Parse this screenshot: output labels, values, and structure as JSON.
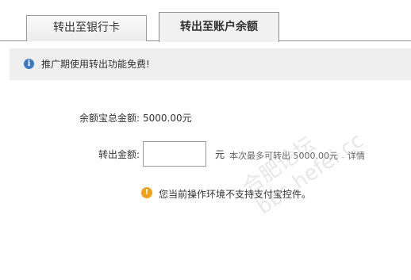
{
  "tabs": [
    {
      "label": "转出至银行卡",
      "active": false
    },
    {
      "label": "转出至账户余额",
      "active": true
    }
  ],
  "notice": {
    "icon": "info-icon",
    "text": "推广期使用转出功能免费!"
  },
  "form": {
    "total_label": "余额宝总金额:",
    "total_value": "5000.00元",
    "amount_label": "转出金额:",
    "amount_value": "",
    "unit": "元",
    "hint": "本次最多可转出 5000.00元",
    "detail_link": "详情"
  },
  "warning": {
    "icon": "warning-icon",
    "text": "您当前操作环境不支持支付宝控件。"
  },
  "watermark": {
    "text": "合肥论坛 bbs.hefei.cc"
  },
  "colors": {
    "info_icon": "#3b79c7",
    "warning_icon": "#f0a21a",
    "notice_bg": "#efefef"
  }
}
